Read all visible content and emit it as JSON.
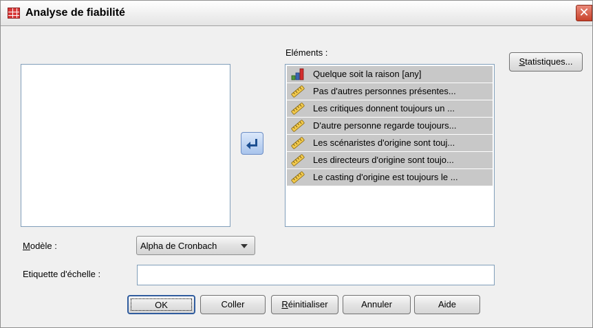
{
  "window": {
    "title": "Analyse de fiabilité"
  },
  "icons": {
    "app": "table-grid-icon",
    "close": "close-icon",
    "transfer": "arrow-left-icon",
    "nominal": "nominal-bar-chart-icon",
    "scale": "ruler-icon"
  },
  "elements_label": "Eléments :",
  "items": [
    {
      "label": "Quelque soit la raison [any]",
      "icon": "nominal"
    },
    {
      "label": "Pas d'autres personnes présentes...",
      "icon": "scale"
    },
    {
      "label": "Les critiques donnent toujours un ...",
      "icon": "scale"
    },
    {
      "label": "D'autre personne regarde toujours...",
      "icon": "scale"
    },
    {
      "label": "Les scénaristes d'origine sont touj...",
      "icon": "scale"
    },
    {
      "label": "Les directeurs d'origine sont toujo...",
      "icon": "scale"
    },
    {
      "label": "Le casting d'origine est toujours le ...",
      "icon": "scale"
    }
  ],
  "statistics_button": {
    "accel": "S",
    "rest": "tatistiques..."
  },
  "model": {
    "label_accel": "M",
    "label_rest": "odèle :",
    "value": "Alpha de Cronbach"
  },
  "scale_label": {
    "label": "Etiquette d'échelle :",
    "value": ""
  },
  "buttons": {
    "ok": "OK",
    "paste": "Coller",
    "reset_accel": "R",
    "reset_rest": "éinitialiser",
    "cancel": "Annuler",
    "help": "Aide"
  }
}
